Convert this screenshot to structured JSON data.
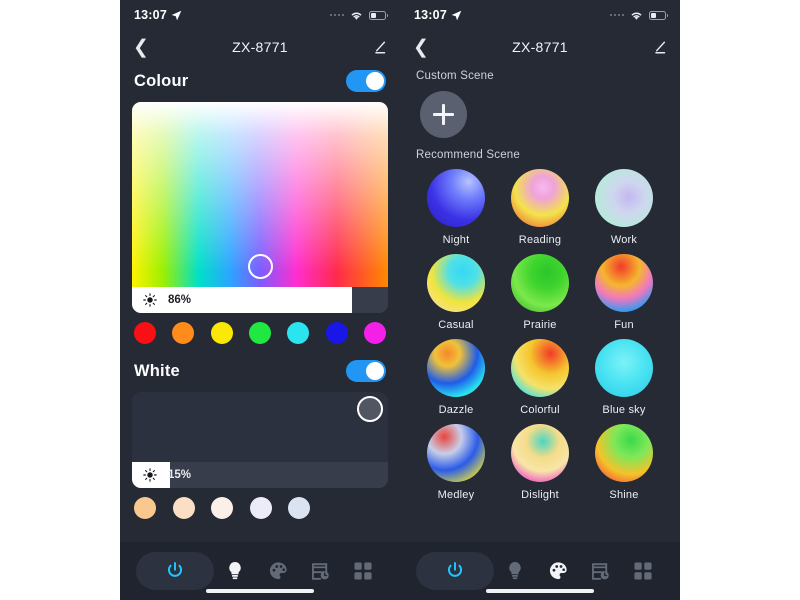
{
  "app": {
    "background": "#ffffff",
    "panel_bg": "#252a35",
    "accent": "#2196f3",
    "power_accent": "#1ec8ff"
  },
  "status_bar": {
    "time": "13:07",
    "location_icon": "location-arrow-icon",
    "signal_icon": "signal-dots-icon",
    "wifi_icon": "wifi-icon",
    "battery_icon": "battery-icon"
  },
  "nav": {
    "back_icon": "chevron-left-icon",
    "title": "ZX-8771",
    "edit_icon": "pencil-edit-icon"
  },
  "left_panel": {
    "colour": {
      "title": "Colour",
      "toggle_on": true,
      "picker": {
        "x_pct": 50,
        "y_pct": 89
      },
      "brightness": {
        "value": "86%",
        "percent": 86,
        "icon": "brightness-sun-icon"
      },
      "swatches": [
        {
          "name": "red",
          "hex": "#fa0f14"
        },
        {
          "name": "orange",
          "hex": "#ff8c1a"
        },
        {
          "name": "yellow",
          "hex": "#fbe805"
        },
        {
          "name": "green",
          "hex": "#20e840"
        },
        {
          "name": "cyan",
          "hex": "#2ae4f0"
        },
        {
          "name": "blue",
          "hex": "#1b16e8"
        },
        {
          "name": "magenta",
          "hex": "#f520e8"
        }
      ]
    },
    "white": {
      "title": "White",
      "toggle_on": true,
      "picker": {
        "x_pct": 93
      },
      "brightness": {
        "value": "15%",
        "percent": 15,
        "icon": "brightness-sun-icon"
      },
      "swatches": [
        {
          "name": "warm-1",
          "hex": "#f8c88f"
        },
        {
          "name": "warm-2",
          "hex": "#fadfc4"
        },
        {
          "name": "neutral",
          "hex": "#faf0e8"
        },
        {
          "name": "cool-1",
          "hex": "#ebecf7"
        },
        {
          "name": "cool-2",
          "hex": "#d9e3f2"
        }
      ]
    }
  },
  "right_panel": {
    "custom_scene_label": "Custom Scene",
    "add_button_icon": "plus-icon",
    "recommend_scene_label": "Recommend Scene",
    "scenes": [
      {
        "name": "Night",
        "gradient": "radial-gradient(circle at 72% 22%, #b7c4ff 0%, #6f7dfb 28%, #3b32e6 62%, #2a1fbf 100%)"
      },
      {
        "name": "Reading",
        "gradient": "radial-gradient(circle at 55% 32%, #f7b8f0 0%, #efa3d8 22%, #f3e34a 55%, #f2953f 78%, #f0a85a 100%)"
      },
      {
        "name": "Work",
        "gradient": "radial-gradient(circle at 58% 48%, #c3b7f0 0%, #cfd6ef 35%, #b9e8dc 70%, #d8e4f2 100%)"
      },
      {
        "name": "Casual",
        "gradient": "radial-gradient(circle at 62% 30%, #36d8f5 0%, #4fe0e8 26%, #f2e43c 58%, #f5e27a 78%, #55e058 100%)"
      },
      {
        "name": "Prairie",
        "gradient": "radial-gradient(circle at 62% 32%, #2cc62c 0%, #3fd42e 30%, #7ce84c 62%, #27a81f 100%)"
      },
      {
        "name": "Fun",
        "gradient": "radial-gradient(circle at 45% 22%, #f23a2a 0%, #f5b62e 34%, #f078c0 58%, #2a9cf0 82%, #3ad8ec 100%)"
      },
      {
        "name": "Dazzle",
        "gradient": "radial-gradient(circle at 35% 25%, #f5882a 0%, #f0c23a 22%, #1f5ce8 52%, #2ae0f0 76%, #3ae05a 100%)"
      },
      {
        "name": "Colorful",
        "gradient": "radial-gradient(circle at 68% 25%, #f23a2a 0%, #f5c62e 35%, #f5e26a 60%, #3ae0ec 85%, #6ae8f2 100%)"
      },
      {
        "name": "Blue sky",
        "gradient": "radial-gradient(circle at 50% 40%, #7df2f8 0%, #4ce4f2 45%, #3ad6ee 75%, #2ec8e8 100%)"
      },
      {
        "name": "Medley",
        "gradient": "radial-gradient(circle at 30% 22%, #e8453a 0%, #c9cde8 28%, #2a5ce8 55%, #f5e82a 88%, #f2f04a 100%)"
      },
      {
        "name": "Dislight",
        "gradient": "radial-gradient(circle at 55% 30%, #49d6c2 0%, #f5dc8a 32%, #f7e6a8 58%, #f23ac8 88%, #f56ad8 100%)"
      },
      {
        "name": "Shine",
        "gradient": "radial-gradient(circle at 62% 28%, #3ad84a 0%, #7ce85a 30%, #f5c22a 62%, #f2553a 88%, #f07a3a 100%)"
      }
    ]
  },
  "tabbar": {
    "items": [
      {
        "name": "power",
        "icon": "power-icon",
        "active": true
      },
      {
        "name": "light",
        "icon": "bulb-icon",
        "active": false
      },
      {
        "name": "scene",
        "icon": "palette-icon",
        "active": false
      },
      {
        "name": "schedule",
        "icon": "schedule-icon",
        "active": false
      },
      {
        "name": "more",
        "icon": "grid-icon",
        "active": false
      }
    ],
    "left_active_tab": "light",
    "right_active_tab": "scene"
  }
}
